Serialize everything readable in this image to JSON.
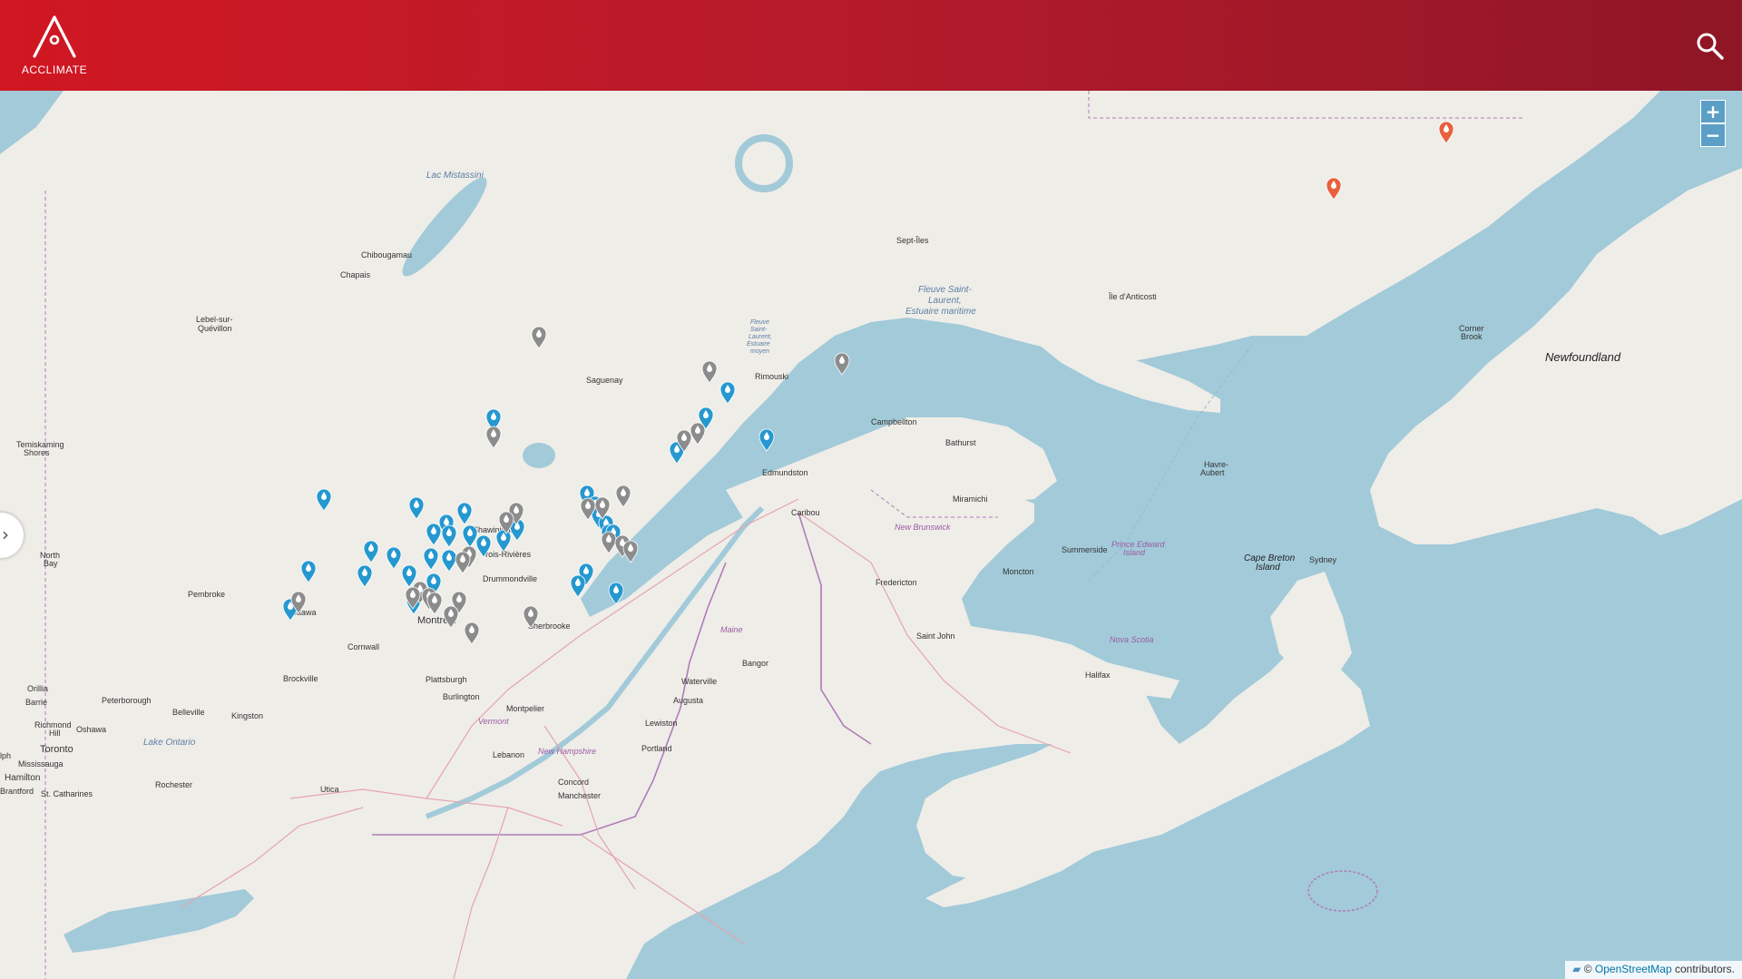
{
  "header": {
    "logo_text": "ACCLIMATE",
    "brand_color": "#c8192a",
    "search_icon": "search-icon"
  },
  "map": {
    "zoom_in_label": "+",
    "zoom_out_label": "−",
    "attribution_prefix": "©",
    "attribution_link": "OpenStreetMap",
    "attribution_suffix": "contributors.",
    "colors": {
      "water": "#a2cad9",
      "land": "#efede8",
      "border": "#b07cb8",
      "road": "#e5a4b0",
      "marker_blue": "#2598d0",
      "marker_gray": "#8c8c8c",
      "marker_orange": "#e8603c"
    },
    "labels": {
      "lac_mistassini": "Lac Mistassini",
      "chibougamau": "Chibougamau",
      "chapais": "Chapais",
      "lebel": "Lebel-sur-",
      "lebel2": "Quévillon",
      "sept_iles": "Sept-Îles",
      "fleuve1": "Fleuve Saint-",
      "fleuve2": "Laurent,",
      "fleuve3": "Estuaire maritime",
      "estuaire1": "Fleuve",
      "estuaire2": "Saint-",
      "estuaire3": "Laurent,",
      "estuaire4": "Estuaire",
      "estuaire5": "moyen",
      "anticosti": "Île d'Anticosti",
      "rimouski": "Rimouski",
      "saguenay": "Saguenay",
      "corner1": "Corner",
      "corner2": "Brook",
      "newfoundland": "Newfoundland",
      "campbellton": "Campbellton",
      "bathurst": "Bathurst",
      "havre1": "Havre-",
      "havre2": "Aubert",
      "timiskaming1": "Temiskaming",
      "timiskaming2": "Shores",
      "edmundston": "Edmundston",
      "miramichi": "Miramichi",
      "caribou": "Caribou",
      "new_brunswick": "New Brunswick",
      "shawinigan": "Shawinigan",
      "north1": "North",
      "north2": "Bay",
      "trois_rivieres": "Trois-Rivières",
      "summerside": "Summerside",
      "pei1": "Prince Edward",
      "pei2": "Island",
      "cape1": "Cape Breton",
      "cape2": "Island",
      "sydney": "Sydney",
      "drummondville": "Drummondville",
      "fredericton": "Fredericton",
      "moncton": "Moncton",
      "pembroke": "Pembroke",
      "ottawa": "Ottawa",
      "montreal": "Montréal",
      "sherbrooke": "Sherbrooke",
      "maine": "Maine",
      "saint_john": "Saint John",
      "nova_scotia": "Nova Scotia",
      "cornwall": "Cornwall",
      "bangor": "Bangor",
      "halifax": "Halifax",
      "brockville": "Brockville",
      "plattsburgh": "Plattsburgh",
      "waterville": "Waterville",
      "orillia": "Orillia",
      "barrie": "Barrie",
      "peterborough": "Peterborough",
      "burlington": "Burlington",
      "augusta": "Augusta",
      "belleville": "Belleville",
      "kingston": "Kingston",
      "montpelier": "Montpelier",
      "richmond1": "Richmond",
      "richmond2": "Hill",
      "oshawa": "Oshawa",
      "vermont": "Vermont",
      "lewiston": "Lewiston",
      "toronto": "Toronto",
      "lake_ontario": "Lake Ontario",
      "portland": "Portland",
      "lebanon": "Lebanon",
      "new_hampshire": "New Hampshire",
      "mississauga": "Mississauga",
      "hamilton": "Hamilton",
      "concord": "Concord",
      "brantford": "Brantford",
      "st_catharines": "St. Catharines",
      "rochester": "Rochester",
      "utica": "Utica",
      "manchester": "Manchester",
      "guelph": "lph"
    }
  }
}
